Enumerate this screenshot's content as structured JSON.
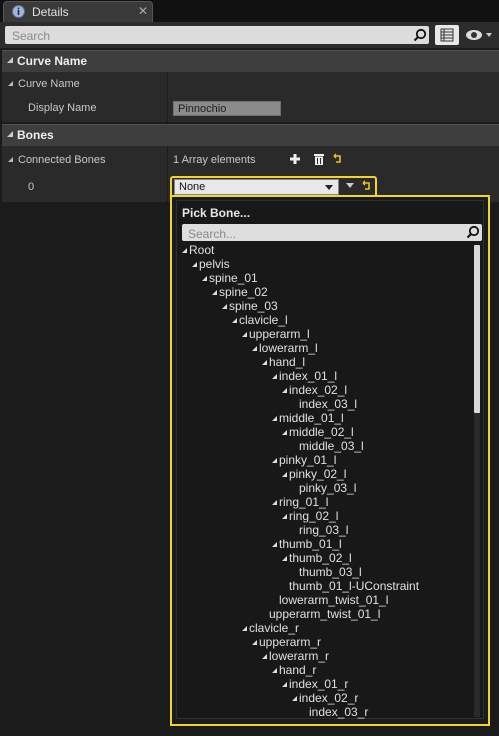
{
  "tab": {
    "title": "Details",
    "icon": "info-icon",
    "close": "✕"
  },
  "search": {
    "placeholder": "Search"
  },
  "categories": {
    "curve": "Curve Name",
    "bones": "Bones"
  },
  "curve": {
    "group_label": "Curve Name",
    "display_name_label": "Display Name",
    "display_name_value": "Pinnochio"
  },
  "bones": {
    "connected_label": "Connected Bones",
    "array_text": "1 Array elements",
    "index_label": "0",
    "selected_bone": "None"
  },
  "picker": {
    "title": "Pick Bone...",
    "search_placeholder": "Search...",
    "nodes": [
      {
        "label": "Root",
        "depth": 0,
        "expandable": true
      },
      {
        "label": "pelvis",
        "depth": 1,
        "expandable": true
      },
      {
        "label": "spine_01",
        "depth": 2,
        "expandable": true
      },
      {
        "label": "spine_02",
        "depth": 3,
        "expandable": true
      },
      {
        "label": "spine_03",
        "depth": 4,
        "expandable": true
      },
      {
        "label": "clavicle_l",
        "depth": 5,
        "expandable": true
      },
      {
        "label": "upperarm_l",
        "depth": 6,
        "expandable": true
      },
      {
        "label": "lowerarm_l",
        "depth": 7,
        "expandable": true
      },
      {
        "label": "hand_l",
        "depth": 8,
        "expandable": true
      },
      {
        "label": "index_01_l",
        "depth": 9,
        "expandable": true
      },
      {
        "label": "index_02_l",
        "depth": 10,
        "expandable": true
      },
      {
        "label": "index_03_l",
        "depth": 11,
        "expandable": false
      },
      {
        "label": "middle_01_l",
        "depth": 9,
        "expandable": true
      },
      {
        "label": "middle_02_l",
        "depth": 10,
        "expandable": true
      },
      {
        "label": "middle_03_l",
        "depth": 11,
        "expandable": false
      },
      {
        "label": "pinky_01_l",
        "depth": 9,
        "expandable": true
      },
      {
        "label": "pinky_02_l",
        "depth": 10,
        "expandable": true
      },
      {
        "label": "pinky_03_l",
        "depth": 11,
        "expandable": false
      },
      {
        "label": "ring_01_l",
        "depth": 9,
        "expandable": true
      },
      {
        "label": "ring_02_l",
        "depth": 10,
        "expandable": true
      },
      {
        "label": "ring_03_l",
        "depth": 11,
        "expandable": false
      },
      {
        "label": "thumb_01_l",
        "depth": 9,
        "expandable": true
      },
      {
        "label": "thumb_02_l",
        "depth": 10,
        "expandable": true
      },
      {
        "label": "thumb_03_l",
        "depth": 11,
        "expandable": false
      },
      {
        "label": "thumb_01_l-UConstraint",
        "depth": 10,
        "expandable": false
      },
      {
        "label": "lowerarm_twist_01_l",
        "depth": 9,
        "expandable": false
      },
      {
        "label": "upperarm_twist_01_l",
        "depth": 8,
        "expandable": false
      },
      {
        "label": "clavicle_r",
        "depth": 6,
        "expandable": true
      },
      {
        "label": "upperarm_r",
        "depth": 7,
        "expandable": true
      },
      {
        "label": "lowerarm_r",
        "depth": 8,
        "expandable": true
      },
      {
        "label": "hand_r",
        "depth": 9,
        "expandable": true
      },
      {
        "label": "index_01_r",
        "depth": 10,
        "expandable": true
      },
      {
        "label": "index_02_r",
        "depth": 11,
        "expandable": true
      },
      {
        "label": "index_03_r",
        "depth": 12,
        "expandable": false
      }
    ]
  },
  "colors": {
    "highlight": "#f1d52d",
    "panel": "#2a2a2a",
    "header": "#3e3e3e"
  }
}
